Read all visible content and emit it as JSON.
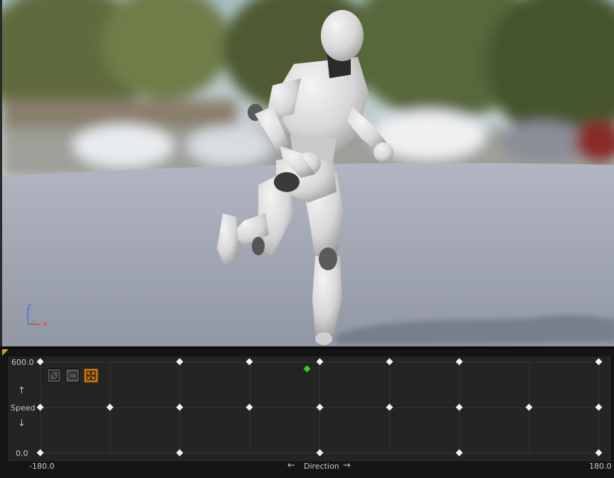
{
  "viewport": {
    "axis_labels": {
      "z": "Z",
      "x": "X"
    }
  },
  "blend_space": {
    "vertical_axis": {
      "max_label": "600.0",
      "min_label": "0.0",
      "name": "Speed",
      "min": 0,
      "max": 600
    },
    "horizontal_axis": {
      "min_label": "-180.0",
      "max_label": "180.0",
      "name": "Direction",
      "min": -180,
      "max": 180
    },
    "toolbar": [
      {
        "name": "triangulation-icon",
        "active": false
      },
      {
        "name": "show-animation-names-icon",
        "active": false
      },
      {
        "name": "stretch-to-fit-icon",
        "active": true
      }
    ],
    "samples": [
      {
        "direction": -180,
        "speed": 600
      },
      {
        "direction": -90,
        "speed": 600
      },
      {
        "direction": -45,
        "speed": 600
      },
      {
        "direction": 0,
        "speed": 600
      },
      {
        "direction": 45,
        "speed": 600
      },
      {
        "direction": 90,
        "speed": 600
      },
      {
        "direction": 180,
        "speed": 600
      },
      {
        "direction": -180,
        "speed": 300
      },
      {
        "direction": -135,
        "speed": 300
      },
      {
        "direction": -90,
        "speed": 300
      },
      {
        "direction": -45,
        "speed": 300
      },
      {
        "direction": 0,
        "speed": 300
      },
      {
        "direction": 45,
        "speed": 300
      },
      {
        "direction": 90,
        "speed": 300
      },
      {
        "direction": 135,
        "speed": 300
      },
      {
        "direction": 180,
        "speed": 300
      },
      {
        "direction": -180,
        "speed": 0
      },
      {
        "direction": -90,
        "speed": 0
      },
      {
        "direction": 0,
        "speed": 0
      },
      {
        "direction": 90,
        "speed": 0
      },
      {
        "direction": 180,
        "speed": 0
      }
    ],
    "preview_point": {
      "direction": -8,
      "speed": 555
    },
    "grid_divisions": {
      "x": 8,
      "y": 2
    },
    "colors": {
      "sample": "#f2f2f2",
      "preview": "#2bd62b",
      "active_tool": "#c07a16"
    }
  }
}
